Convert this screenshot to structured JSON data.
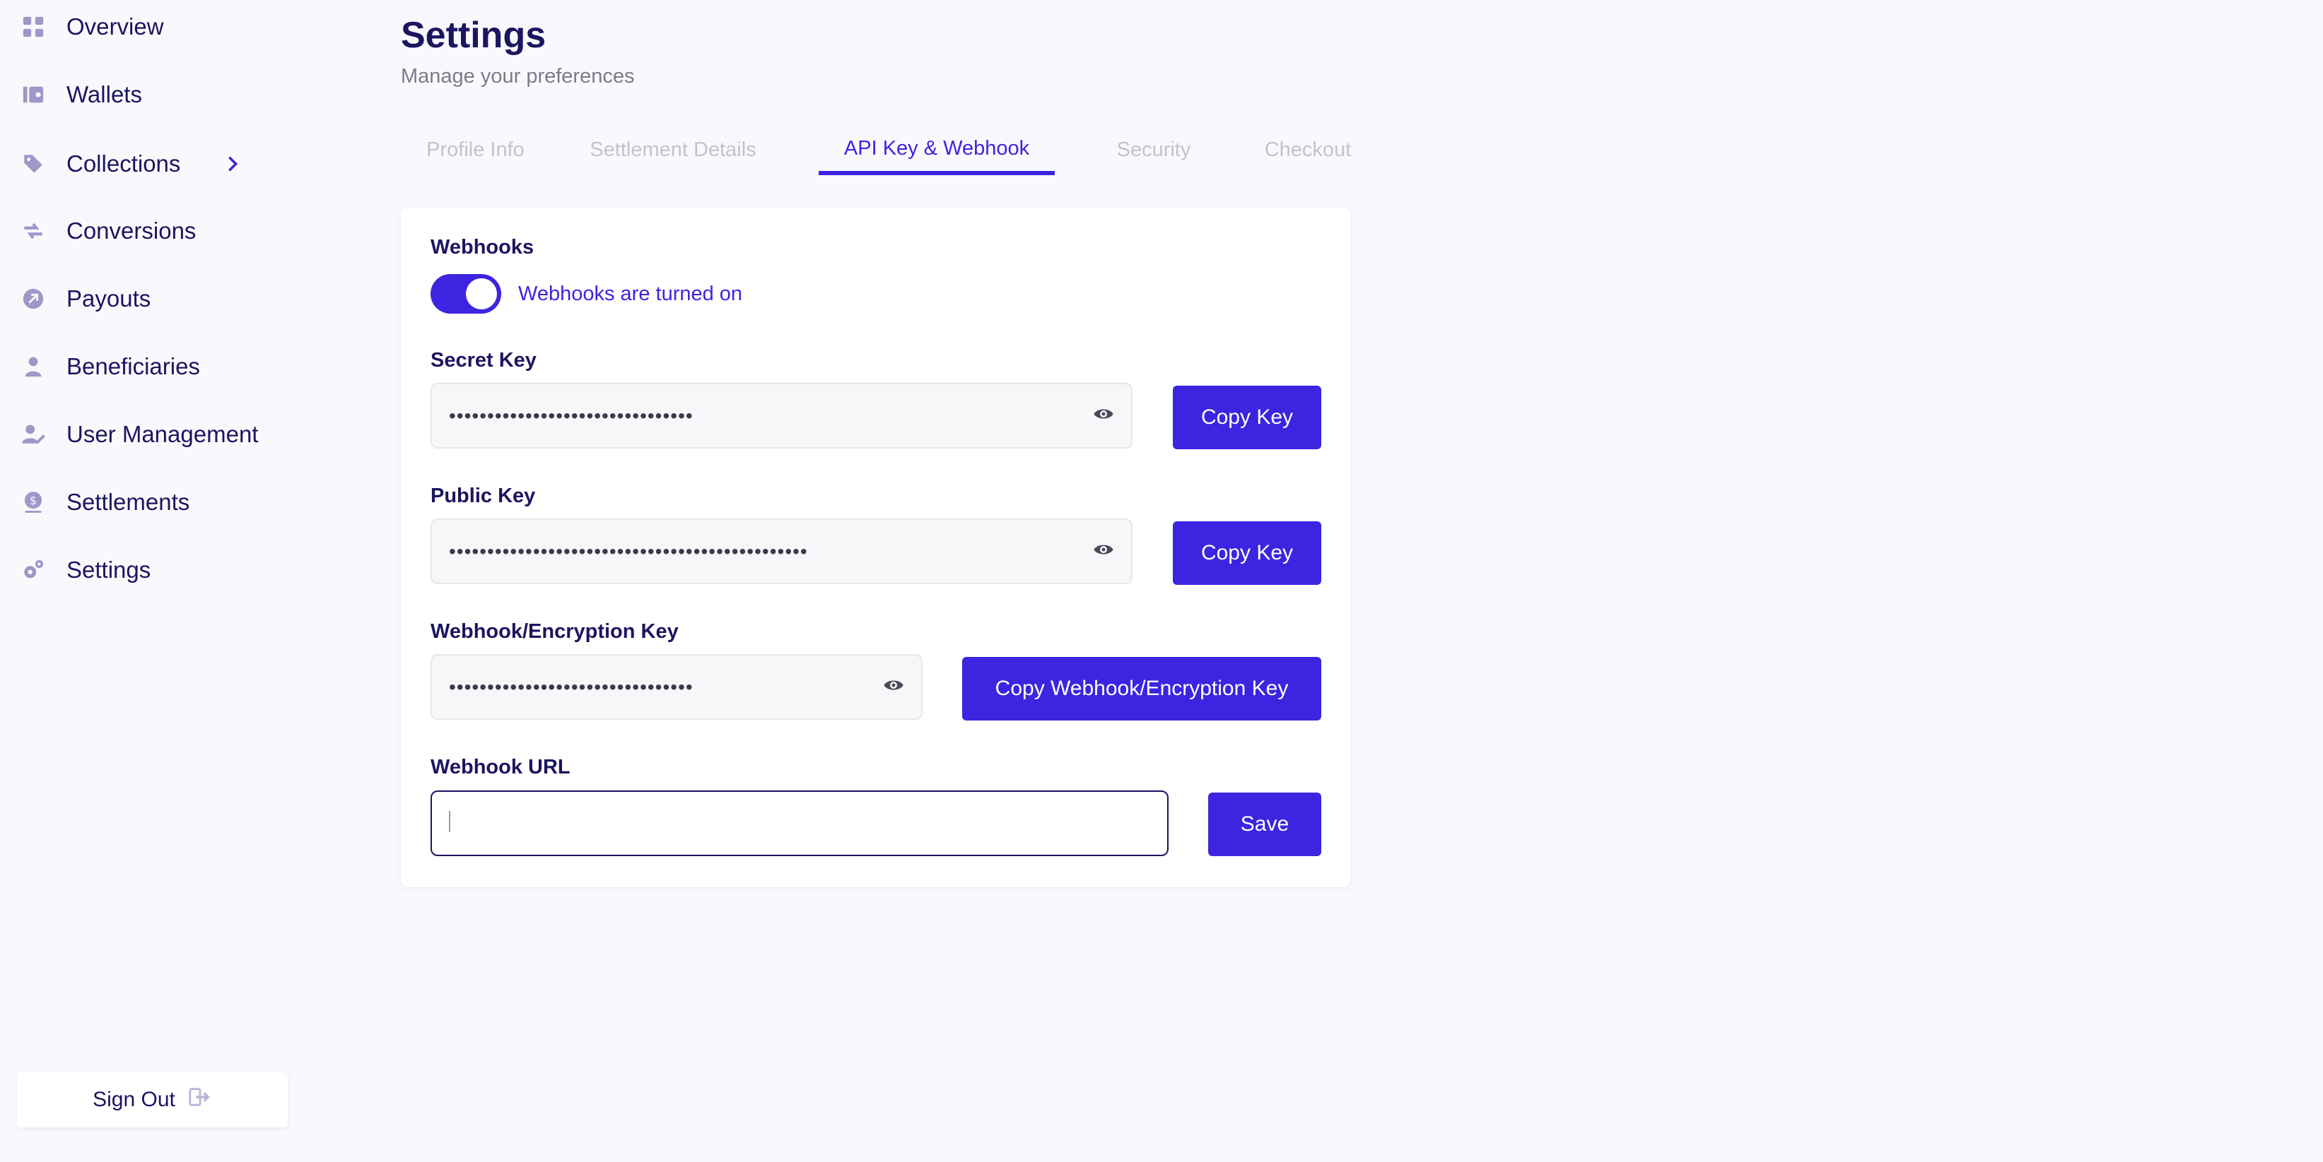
{
  "sidebar": {
    "items": [
      {
        "label": "Overview",
        "icon": "grid-icon"
      },
      {
        "label": "Wallets",
        "icon": "wallet-icon"
      },
      {
        "label": "Collections",
        "icon": "tag-icon"
      },
      {
        "label": "Conversions",
        "icon": "swap-icon"
      },
      {
        "label": "Payouts",
        "icon": "arrow-circle-icon"
      },
      {
        "label": "Beneficiaries",
        "icon": "person-icon"
      },
      {
        "label": "User Management",
        "icon": "user-edit-icon"
      },
      {
        "label": "Settlements",
        "icon": "dollar-coin-icon"
      },
      {
        "label": "Settings",
        "icon": "gear-icon"
      }
    ],
    "signout_label": "Sign Out"
  },
  "header": {
    "title": "Settings",
    "subtitle": "Manage your preferences"
  },
  "tabs": [
    {
      "label": "Profile Info",
      "active": false
    },
    {
      "label": "Settlement Details",
      "active": false
    },
    {
      "label": "API Key & Webhook",
      "active": true
    },
    {
      "label": "Security",
      "active": false
    },
    {
      "label": "Checkout",
      "active": false
    }
  ],
  "webhooks": {
    "section_label": "Webhooks",
    "toggle_text": "Webhooks are turned on",
    "enabled": true
  },
  "secret_key": {
    "label": "Secret Key",
    "masked_value": "••••••••••••••••••••••••••••••••",
    "button": "Copy Key"
  },
  "public_key": {
    "label": "Public Key",
    "masked_value": "•••••••••••••••••••••••••••••••••••••••••••••••",
    "button": "Copy Key"
  },
  "encryption_key": {
    "label": "Webhook/Encryption Key",
    "masked_value": "••••••••••••••••••••••••••••••••",
    "button": "Copy Webhook/Encryption Key"
  },
  "webhook_url": {
    "label": "Webhook URL",
    "value": "",
    "button": "Save"
  },
  "colors": {
    "accent": "#3d24e0",
    "text": "#1c1560",
    "muted_tab": "#c2c2cf",
    "icon": "#9e98c9"
  }
}
